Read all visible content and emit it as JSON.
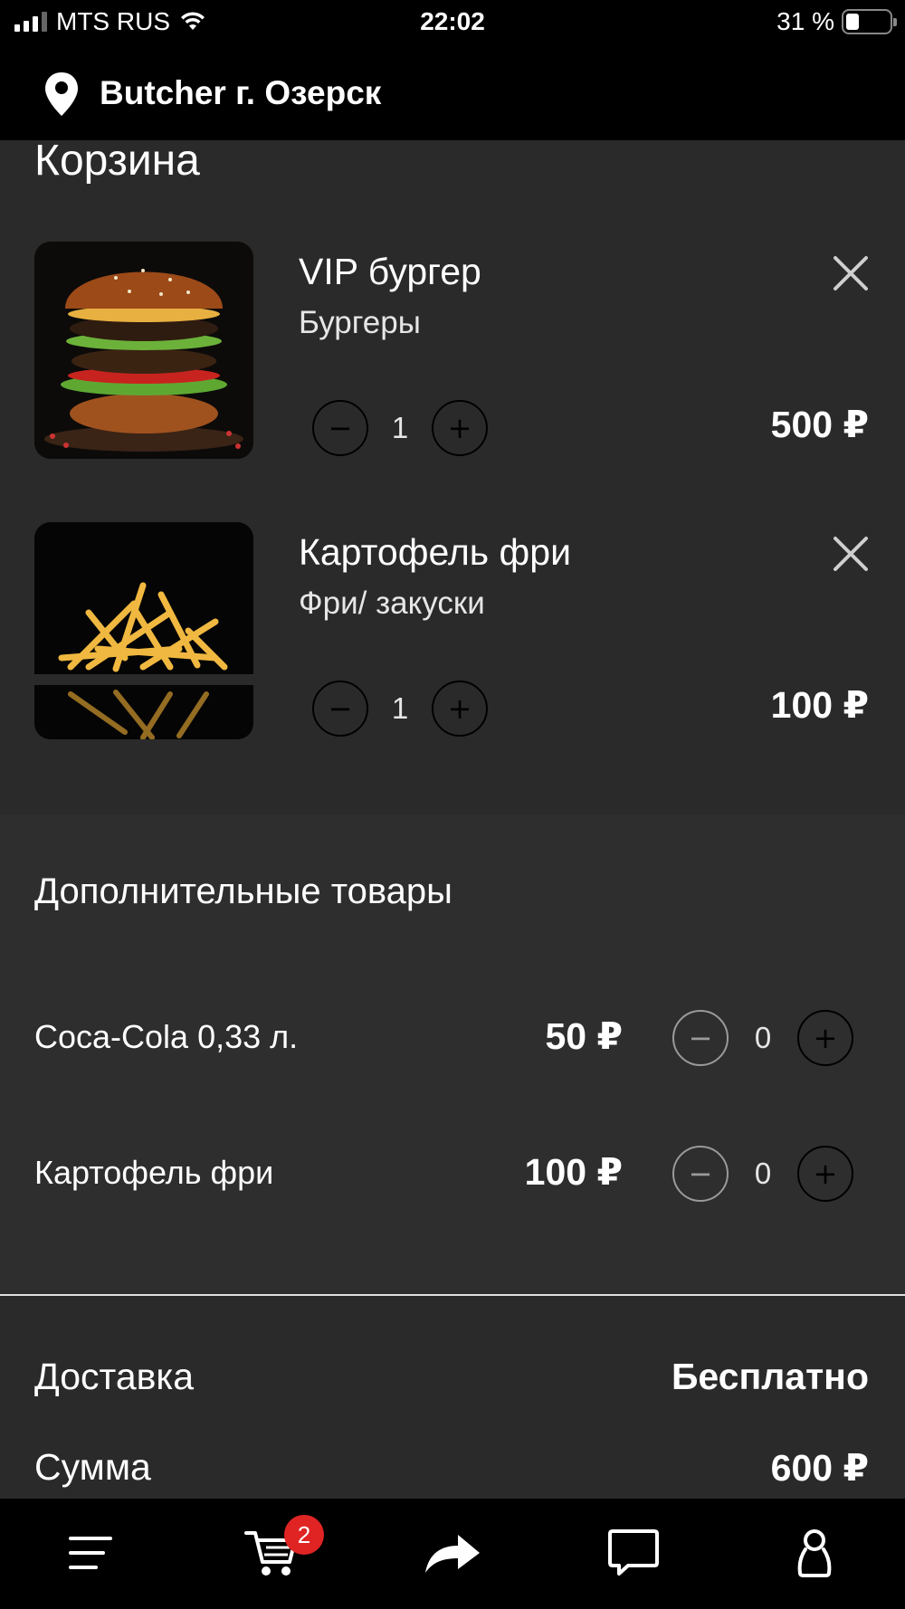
{
  "status_bar": {
    "carrier": "MTS RUS",
    "time": "22:02",
    "battery": "31 %"
  },
  "header": {
    "location_title": "Butcher г. Озерск",
    "icon": "map-pin-icon"
  },
  "cart": {
    "title": "Корзина",
    "items": [
      {
        "name": "VIP бургер",
        "category": "Бургеры",
        "quantity": "1",
        "price": "500 ₽"
      },
      {
        "name": "Картофель фри",
        "category": "Фри/ закуски",
        "quantity": "1",
        "price": "100 ₽"
      }
    ]
  },
  "extras": {
    "title": "Дополнительные товары",
    "items": [
      {
        "name": "Coca-Cola 0,33 л.",
        "price": "50 ₽",
        "quantity": "0"
      },
      {
        "name": "Картофель фри",
        "price": "100 ₽",
        "quantity": "0"
      }
    ]
  },
  "totals": {
    "delivery_label": "Доставка",
    "delivery_value": "Бесплатно",
    "sum_label": "Сумма",
    "sum_value": "600 ₽"
  },
  "tabbar": {
    "cart_badge": "2",
    "icons": [
      "menu-icon",
      "cart-icon",
      "share-icon",
      "chat-icon",
      "profile-icon"
    ]
  },
  "colors": {
    "background": "#2a2a2a",
    "bar": "#000000",
    "badge": "#e02424"
  }
}
